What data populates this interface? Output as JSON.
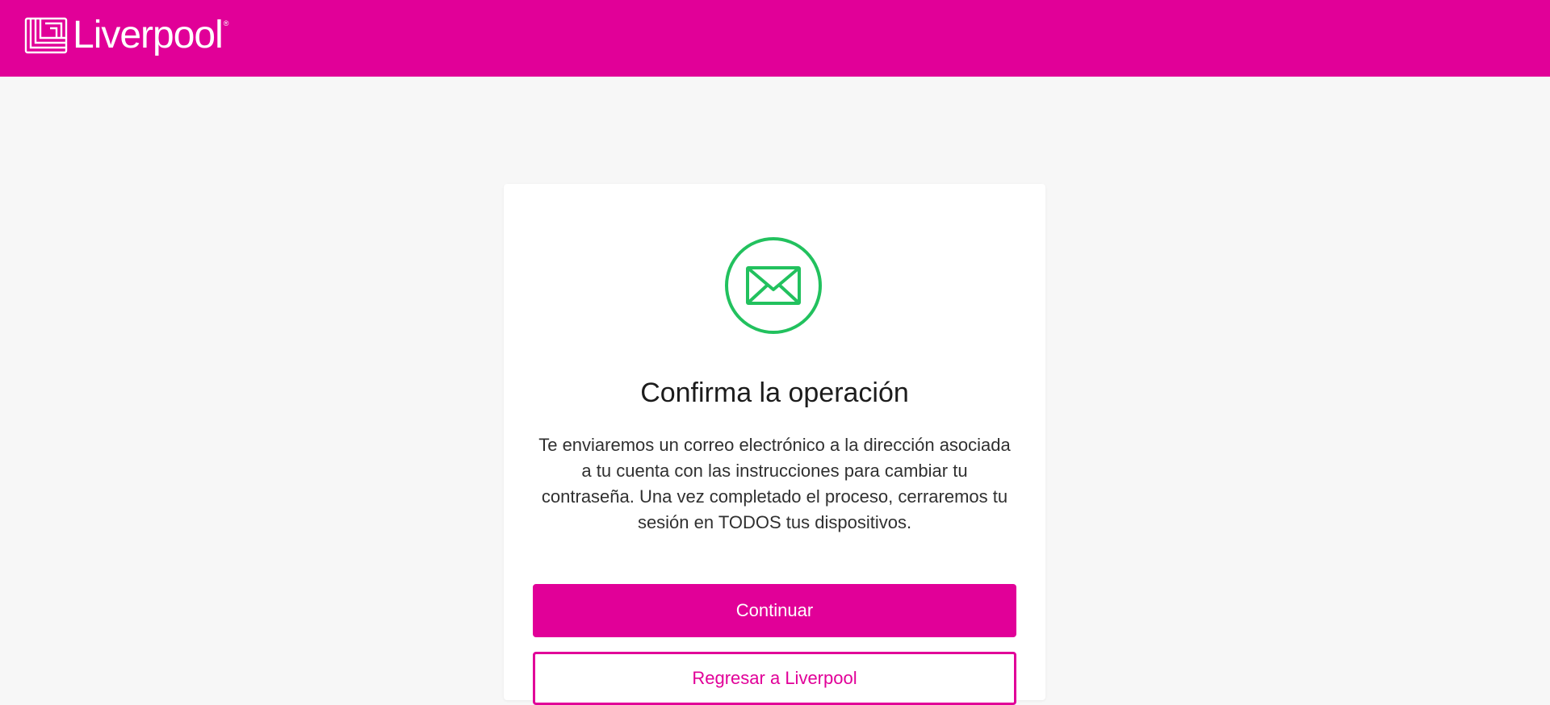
{
  "header": {
    "logo_text": "Liverpool",
    "logo_registered": "®",
    "brand_color": "#e10098"
  },
  "card": {
    "icon": "mail-envelope-icon",
    "icon_color": "#22c15e",
    "title": "Confirma la operación",
    "description": "Te enviaremos un correo electrónico a la dirección asociada a tu cuenta con las instrucciones para cambiar tu contraseña. Una vez completado el proceso, cerraremos tu sesión en TODOS tus dispositivos.",
    "primary_button": "Continuar",
    "secondary_button": "Regresar a Liverpool"
  }
}
